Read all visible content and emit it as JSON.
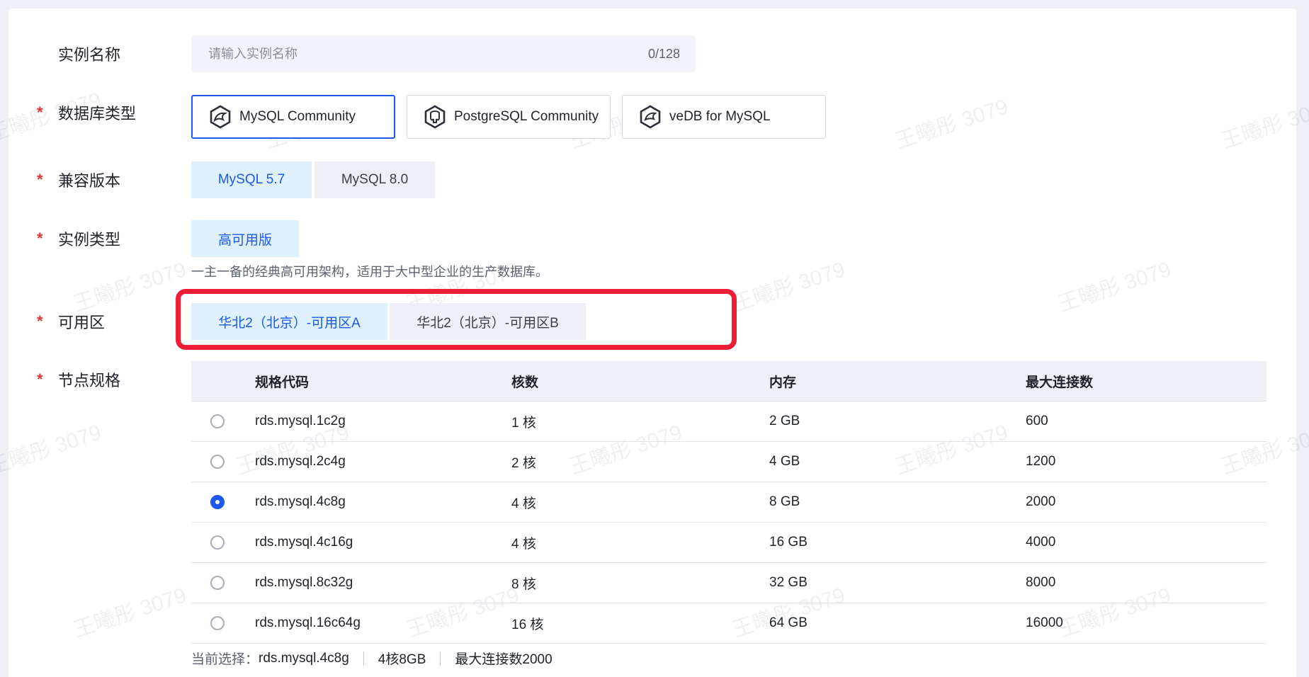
{
  "form": {
    "instance_name": {
      "label": "实例名称",
      "placeholder": "请输入实例名称",
      "counter": "0/128"
    },
    "db_type": {
      "label": "数据库类型",
      "required": "*",
      "options": [
        {
          "label": "MySQL Community",
          "selected": true
        },
        {
          "label": "PostgreSQL Community",
          "selected": false
        },
        {
          "label": "veDB for MySQL",
          "selected": false
        }
      ]
    },
    "version": {
      "label": "兼容版本",
      "required": "*",
      "options": [
        {
          "label": "MySQL 5.7",
          "selected": true
        },
        {
          "label": "MySQL 8.0",
          "selected": false
        }
      ]
    },
    "instance_type": {
      "label": "实例类型",
      "required": "*",
      "options": [
        {
          "label": "高可用版",
          "selected": true
        }
      ],
      "description": "一主一备的经典高可用架构，适用于大中型企业的生产数据库。"
    },
    "zone": {
      "label": "可用区",
      "required": "*",
      "options": [
        {
          "label": "华北2（北京）-可用区A",
          "selected": true
        },
        {
          "label": "华北2（北京）-可用区B",
          "selected": false
        }
      ]
    },
    "node_spec": {
      "label": "节点规格",
      "required": "*",
      "columns": [
        "规格代码",
        "核数",
        "内存",
        "最大连接数"
      ],
      "rows": [
        {
          "code": "rds.mysql.1c2g",
          "cores": "1 核",
          "memory": "2 GB",
          "max_conn": "600",
          "selected": false
        },
        {
          "code": "rds.mysql.2c4g",
          "cores": "2 核",
          "memory": "4 GB",
          "max_conn": "1200",
          "selected": false
        },
        {
          "code": "rds.mysql.4c8g",
          "cores": "4 核",
          "memory": "8 GB",
          "max_conn": "2000",
          "selected": true
        },
        {
          "code": "rds.mysql.4c16g",
          "cores": "4 核",
          "memory": "16 GB",
          "max_conn": "4000",
          "selected": false
        },
        {
          "code": "rds.mysql.8c32g",
          "cores": "8 核",
          "memory": "32 GB",
          "max_conn": "8000",
          "selected": false
        },
        {
          "code": "rds.mysql.16c64g",
          "cores": "16 核",
          "memory": "64 GB",
          "max_conn": "16000",
          "selected": false
        }
      ],
      "summary": {
        "label": "当前选择：",
        "code": "rds.mysql.4c8g",
        "spec": "4核8GB",
        "conn": "最大连接数2000"
      }
    }
  },
  "watermark": "王曦彤 3079",
  "colors": {
    "accent": "#1a58f0",
    "selected_bg": "#dff0ff",
    "required": "#e8333a",
    "highlight_box": "#ef1d35"
  },
  "icons": {
    "mysql": "mysql-logo-icon",
    "postgresql": "postgresql-logo-icon",
    "vedb": "vedb-logo-icon"
  }
}
